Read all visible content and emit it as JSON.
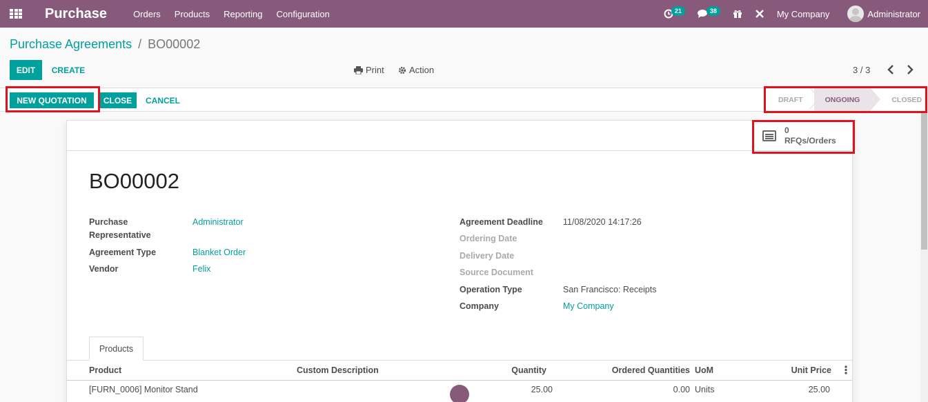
{
  "navbar": {
    "app_name": "Purchase",
    "menu": [
      "Orders",
      "Products",
      "Reporting",
      "Configuration"
    ],
    "activity_count": "21",
    "message_count": "38",
    "company": "My Company",
    "user": "Administrator"
  },
  "breadcrumb": {
    "parent": "Purchase Agreements",
    "separator": "/",
    "current": "BO00002"
  },
  "controls": {
    "edit": "EDIT",
    "create": "CREATE",
    "print": "Print",
    "action": "Action",
    "pager": "3 / 3"
  },
  "statusbar": {
    "new_quotation": "NEW QUOTATION",
    "close": "CLOSE",
    "cancel": "CANCEL",
    "stages": [
      "DRAFT",
      "ONGOING",
      "CLOSED"
    ],
    "active_stage": "ONGOING"
  },
  "smart_button": {
    "count": "0",
    "label": "RFQs/Orders"
  },
  "record": {
    "name": "BO00002",
    "left_fields": [
      {
        "label": "Purchase Representative",
        "value": "Administrator"
      },
      {
        "label": "Agreement Type",
        "value": "Blanket Order"
      },
      {
        "label": "Vendor",
        "value": "Felix"
      }
    ],
    "right_fields": [
      {
        "label": "Agreement Deadline",
        "value": "11/08/2020 14:17:26"
      },
      {
        "label": "Ordering Date",
        "value": ""
      },
      {
        "label": "Delivery Date",
        "value": ""
      },
      {
        "label": "Source Document",
        "value": ""
      },
      {
        "label": "Operation Type",
        "value": "San Francisco: Receipts"
      },
      {
        "label": "Company",
        "value": "My Company"
      }
    ]
  },
  "tabs": [
    "Products"
  ],
  "table": {
    "columns": [
      "Product",
      "Custom Description",
      "Quantity",
      "Ordered Quantities",
      "UoM",
      "Unit Price"
    ],
    "rows": [
      {
        "product": "[FURN_0006] Monitor Stand",
        "description": "",
        "quantity": "25.00",
        "ordered": "0.00",
        "uom": "Units",
        "unit_price": "25.00"
      }
    ]
  },
  "colors": {
    "brand": "#875a7b",
    "accent": "#00a09d",
    "highlight": "#e0121e"
  }
}
